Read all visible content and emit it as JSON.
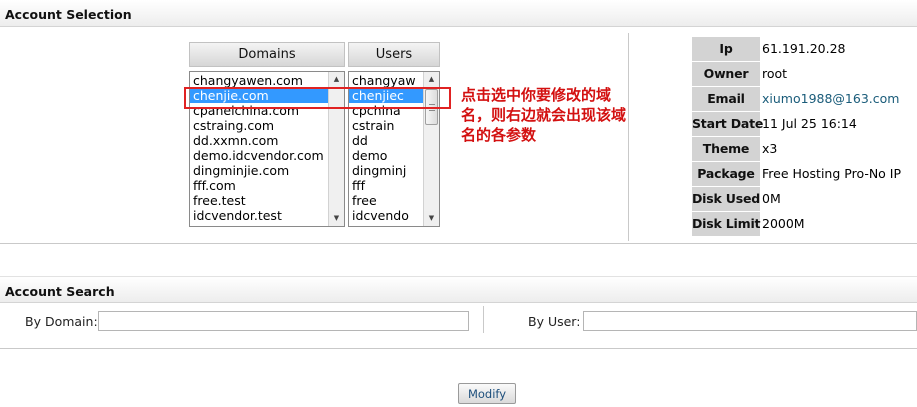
{
  "account_selection": {
    "title": "Account Selection",
    "domains_header": "Domains",
    "users_header": "Users",
    "domains": [
      "changyawen.com",
      "chenjie.com",
      "cpanelchina.com",
      "cstraing.com",
      "dd.xxmn.com",
      "demo.idcvendor.com",
      "dingminjie.com",
      "fff.com",
      "free.test",
      "idcvendor.test"
    ],
    "users": [
      "changyaw",
      "chenjiec",
      "cpchina",
      "cstrain",
      "dd",
      "demo",
      "dingminj",
      "fff",
      "free",
      "idcvendo"
    ],
    "selected_index": 1,
    "annotation": "点击选中你要修改的域名，则右边就会出现该域名的各参数"
  },
  "account_info": [
    {
      "label": "Ip",
      "value": "61.191.20.28"
    },
    {
      "label": "Owner",
      "value": "root"
    },
    {
      "label": "Email",
      "value": "xiumo1988@163.com"
    },
    {
      "label": "Start Date",
      "value": "11 Jul 25 16:14"
    },
    {
      "label": "Theme",
      "value": "x3"
    },
    {
      "label": "Package",
      "value": "Free Hosting Pro-No IP"
    },
    {
      "label": "Disk Used",
      "value": "0M"
    },
    {
      "label": "Disk Limit",
      "value": "2000M"
    }
  ],
  "account_search": {
    "title": "Account Search",
    "by_domain_label": "By Domain:",
    "by_domain_value": "",
    "by_user_label": "By User:",
    "by_user_value": ""
  },
  "modify_label": "Modify",
  "colors": {
    "selection": "#3399ff",
    "annotation": "#d31010",
    "label_bg": "#d3d3d3"
  }
}
